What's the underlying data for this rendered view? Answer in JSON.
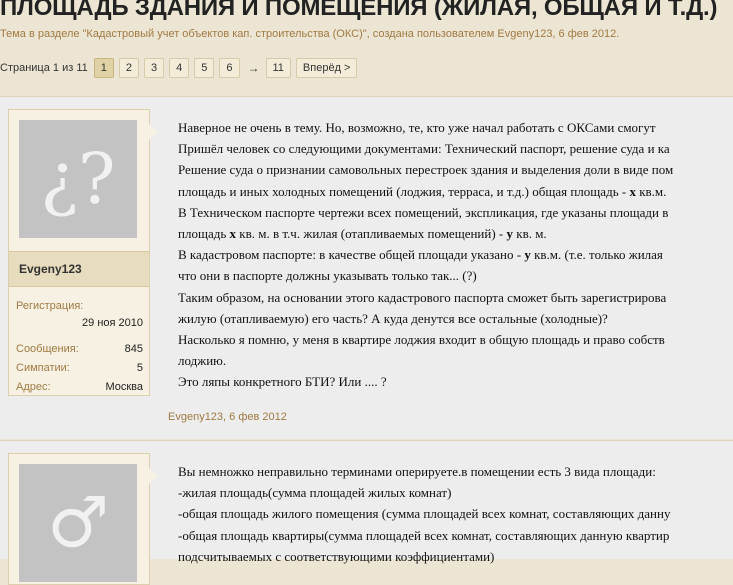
{
  "thread": {
    "title": "ПЛОЩАДЬ ЗДАНИЯ И ПОМЕЩЕНИЯ (ЖИЛАЯ, ОБЩАЯ И Т.Д.)",
    "subtitle": "Тема в разделе \"Кадастровый учет объектов кап. строительства (ОКС)\", создана пользователем Evgeny123, 6 фев 2012."
  },
  "pagination": {
    "label": "Страница 1 из 11",
    "pages": [
      "1",
      "2",
      "3",
      "4",
      "5",
      "6"
    ],
    "arrow": "→",
    "last": "11",
    "next": "Вперёд >"
  },
  "post1": {
    "avatar_glyph": "¿?",
    "username": "Evgeny123",
    "reg_label": "Регистрация:",
    "reg_value": "29 ноя 2010",
    "msgs_label": "Сообщения:",
    "msgs_value": "845",
    "likes_label": "Симпатии:",
    "likes_value": "5",
    "addr_label": "Адрес:",
    "addr_value": "Москва",
    "lines": [
      "Наверное не очень в тему. Но, возможно, те, кто уже начал работать с ОКСами смогут",
      "Пришёл человек со следующими документами: Технический паспорт, решение суда и ка",
      "Решение суда о признании самовольных перестроек здания и выделения доли в виде пом",
      "площадь и иных холодных помещений (лоджия, терраса, и т.д.) общая площадь - ",
      "x",
      " кв.м.",
      "В Техническом паспорте чертежи всех помещений, экспликация, где указаны площади в",
      "площадь ",
      "x",
      " кв. м. в т.ч. жилая (отапливаемых помещений) - ",
      "y",
      " кв. м.",
      "В кадастровом паспорте: в качестве общей площади указано - ",
      "y",
      " кв.м. (т.е. только жилая",
      "что они в паспорте должны указывать только так... (?)",
      "Таким образом, на основании этого кадастрового паспорта сможет быть зарегистрирова",
      "жилую (отапливаемую) его часть? А куда денутся все остальные (холодные)?",
      "Насколько я помню, у меня в квартире лоджия входит в общую площадь и право собств",
      "лоджию.",
      "Это ляпы конкретного БТИ? Или .... ?"
    ],
    "footer": "Evgeny123, 6 фев 2012"
  },
  "post2": {
    "avatar_glyph": "♂",
    "lines": [
      "Вы немножко неправильно терминами оперируете.в помещении есть 3 вида площади:",
      "-жилая площадь(сумма площадей жилых комнат)",
      "-общая площадь жилого помещения (сумма площадей всех комнат, составляющих данну",
      "-общая площадь квартиры(сумма площадей всех комнат, составляющих данную квартир",
      "подсчитываемых с соответствующими коэффициентами)"
    ]
  }
}
